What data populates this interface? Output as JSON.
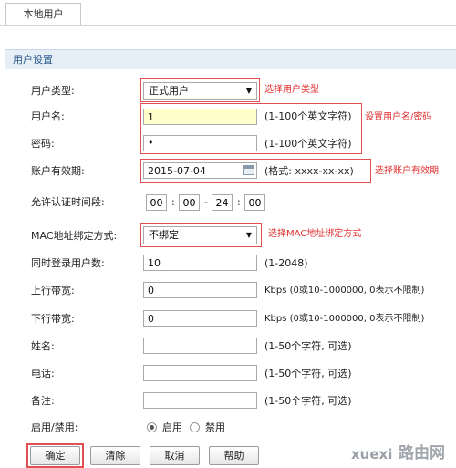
{
  "tab": {
    "label": "本地用户"
  },
  "section": {
    "title": "用户设置"
  },
  "fields": {
    "user_type": {
      "label": "用户类型:",
      "value": "正式用户",
      "annotation": "选择用户类型"
    },
    "username": {
      "label": "用户名:",
      "value": "1",
      "hint": "(1-100个英文字符)",
      "annotation": "设置用户名/密码"
    },
    "password": {
      "label": "密码:",
      "value": "•",
      "hint": "(1-100个英文字符)"
    },
    "expiry": {
      "label": "账户有效期:",
      "value": "2015-07-04",
      "hint": "(格式: xxxx-xx-xx)",
      "annotation": "选择账户有效期"
    },
    "allowed_time": {
      "label": "允许认证时间段:",
      "start_h": "00",
      "start_m": "00",
      "dash": "-",
      "end_h": "24",
      "end_m": "00",
      "colon": ":"
    },
    "mac_binding": {
      "label": "MAC地址绑定方式:",
      "value": "不绑定",
      "annotation": "选择MAC地址绑定方式"
    },
    "concurrent": {
      "label": "同时登录用户数:",
      "value": "10",
      "hint": "(1-2048)"
    },
    "upstream": {
      "label": "上行带宽:",
      "value": "0",
      "hint": "Kbps (0或10-1000000, 0表示不限制)"
    },
    "downstream": {
      "label": "下行带宽:",
      "value": "0",
      "hint": "Kbps (0或10-1000000, 0表示不限制)"
    },
    "name": {
      "label": "姓名:",
      "value": "",
      "hint": "(1-50个字符, 可选)"
    },
    "phone": {
      "label": "电话:",
      "value": "",
      "hint": "(1-50个字符, 可选)"
    },
    "remark": {
      "label": "备注:",
      "value": "",
      "hint": "(1-50个字符, 可选)"
    },
    "status": {
      "label": "启用/禁用:",
      "enable": "启用",
      "disable": "禁用",
      "selected": "enable"
    }
  },
  "buttons": {
    "ok": "确定",
    "clear": "清除",
    "cancel": "取消",
    "help": "帮助"
  },
  "watermark": {
    "text1": "xuexi",
    "text2": "路由网"
  },
  "colors": {
    "annotation": "#e03030",
    "section_bg": "#e6eef6",
    "section_text": "#2a5a8c",
    "highlight_field": "#ffffcc"
  }
}
